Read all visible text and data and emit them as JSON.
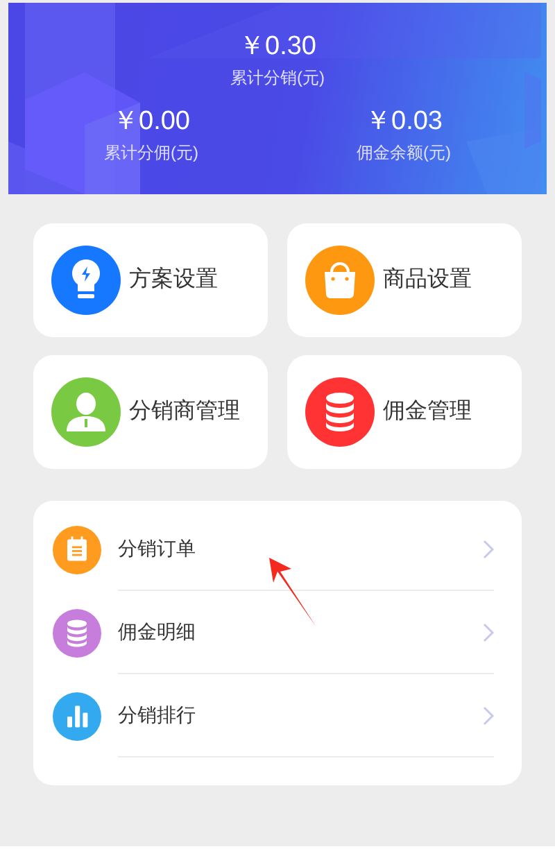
{
  "summary": {
    "main": {
      "value": "￥0.30",
      "label": "累计分销(元)"
    },
    "items": [
      {
        "value": "￥0.00",
        "label": "累计分佣(元)"
      },
      {
        "value": "￥0.03",
        "label": "佣金余额(元)"
      }
    ]
  },
  "tiles": [
    {
      "label": "方案设置",
      "kind": "bulb",
      "color": "#1677ff"
    },
    {
      "label": "商品设置",
      "kind": "bag",
      "color": "#ff9811"
    },
    {
      "label": "分销商管理",
      "kind": "person",
      "color": "#7ac943"
    },
    {
      "label": "佣金管理",
      "kind": "coins",
      "color": "#ff3333"
    }
  ],
  "menu": [
    {
      "label": "分销订单",
      "kind": "clipboard",
      "color": "#ff9b1e"
    },
    {
      "label": "佣金明细",
      "kind": "coins",
      "color": "#c77ddb"
    },
    {
      "label": "分销排行",
      "kind": "chart",
      "color": "#33aaf0"
    }
  ]
}
